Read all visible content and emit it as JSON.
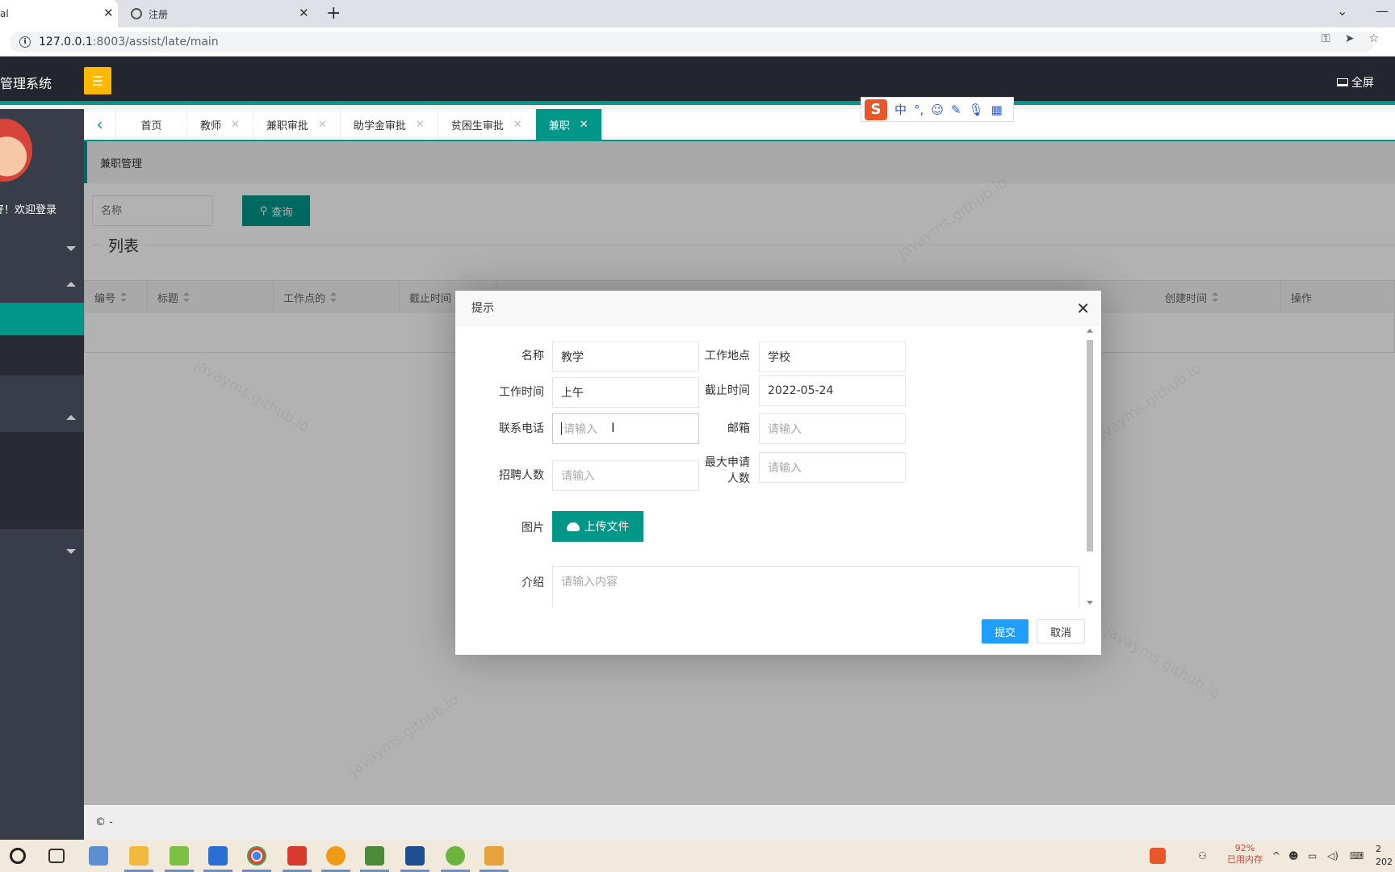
{
  "browser": {
    "tabs": [
      {
        "label": "al",
        "active": true
      },
      {
        "label": "注册",
        "active": false
      }
    ],
    "url_host": "127.0.0.1",
    "url_rest": ":8003/assist/late/main"
  },
  "header": {
    "system_name": "系统管理系统",
    "fullscreen_label": "全屏"
  },
  "sidebar": {
    "welcome": "好！欢迎登录"
  },
  "page_tabs": [
    {
      "label": "首页",
      "closable": false,
      "active": false
    },
    {
      "label": "教师",
      "closable": true,
      "active": false
    },
    {
      "label": "兼职审批",
      "closable": true,
      "active": false
    },
    {
      "label": "助学金审批",
      "closable": true,
      "active": false
    },
    {
      "label": "贫困生审批",
      "closable": true,
      "active": false
    },
    {
      "label": "兼职",
      "closable": true,
      "active": true
    }
  ],
  "breadcrumb": "兼职管理",
  "search": {
    "placeholder": "名称",
    "button_label": "查询"
  },
  "list_title": "列表",
  "table": {
    "columns": [
      "编号",
      "标题",
      "工作点的",
      "截止时间",
      "创建时间",
      "操作"
    ]
  },
  "footer": "© -",
  "ime": {
    "logo": "S",
    "mode": "中"
  },
  "modal": {
    "title": "提示",
    "fields": {
      "name": {
        "label": "名称",
        "value": "教学"
      },
      "location": {
        "label": "工作地点",
        "value": "学校"
      },
      "time": {
        "label": "工作时间",
        "value": "上午"
      },
      "deadline": {
        "label": "截止时间",
        "value": "2022-05-24"
      },
      "phone": {
        "label": "联系电话",
        "placeholder": "请输入"
      },
      "email": {
        "label": "邮箱",
        "placeholder": "请输入"
      },
      "headcount": {
        "label": "招聘人数",
        "placeholder": "请输入"
      },
      "max_applicants": {
        "label": "最大申请人数",
        "placeholder": "请输入"
      },
      "image": {
        "label": "图片"
      },
      "intro": {
        "label": "介绍",
        "placeholder": "请输入内容"
      }
    },
    "upload_label": "上传文件",
    "submit_label": "提交",
    "cancel_label": "取消"
  },
  "taskbar": {
    "memory_percent": "92%",
    "memory_label": "已用内存",
    "clock_partial": "2\n202"
  },
  "watermark_text": "javayms.github.io"
}
